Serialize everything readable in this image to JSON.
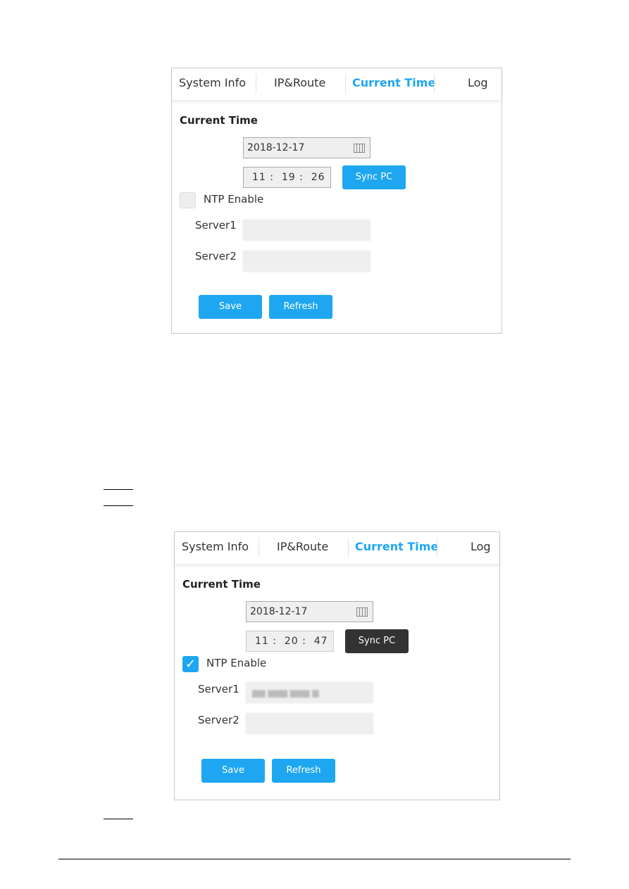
{
  "panels": [
    {
      "tabs": [
        "System Info",
        "IP&Route",
        "Current Time",
        "Log"
      ],
      "active_tab": "Current Time",
      "heading": "Current Time",
      "date": "2018-12-17",
      "time": "11 :  19 :  26",
      "sync_label": "Sync PC",
      "sync_state": "normal",
      "ntp_label": "NTP Enable",
      "ntp_checked": false,
      "server1_label": "Server1",
      "server1_value": "",
      "server2_label": "Server2",
      "server2_value": "",
      "save_label": "Save",
      "refresh_label": "Refresh"
    },
    {
      "tabs": [
        "System Info",
        "IP&Route",
        "Current Time",
        "Log"
      ],
      "active_tab": "Current Time",
      "heading": "Current Time",
      "date": "2018-12-17",
      "time": "11 :  20 :  47",
      "sync_label": "Sync PC",
      "sync_state": "hover",
      "ntp_label": "NTP Enable",
      "ntp_checked": true,
      "check_glyph": "✓",
      "server1_label": "Server1",
      "server1_value": "▆▆ ▆▆▆ ▆▆▆ ▆",
      "server2_label": "Server2",
      "server2_value": "",
      "save_label": "Save",
      "refresh_label": "Refresh"
    }
  ],
  "colors": {
    "accent": "#1ea7f0",
    "sync_hover": "#333333"
  }
}
